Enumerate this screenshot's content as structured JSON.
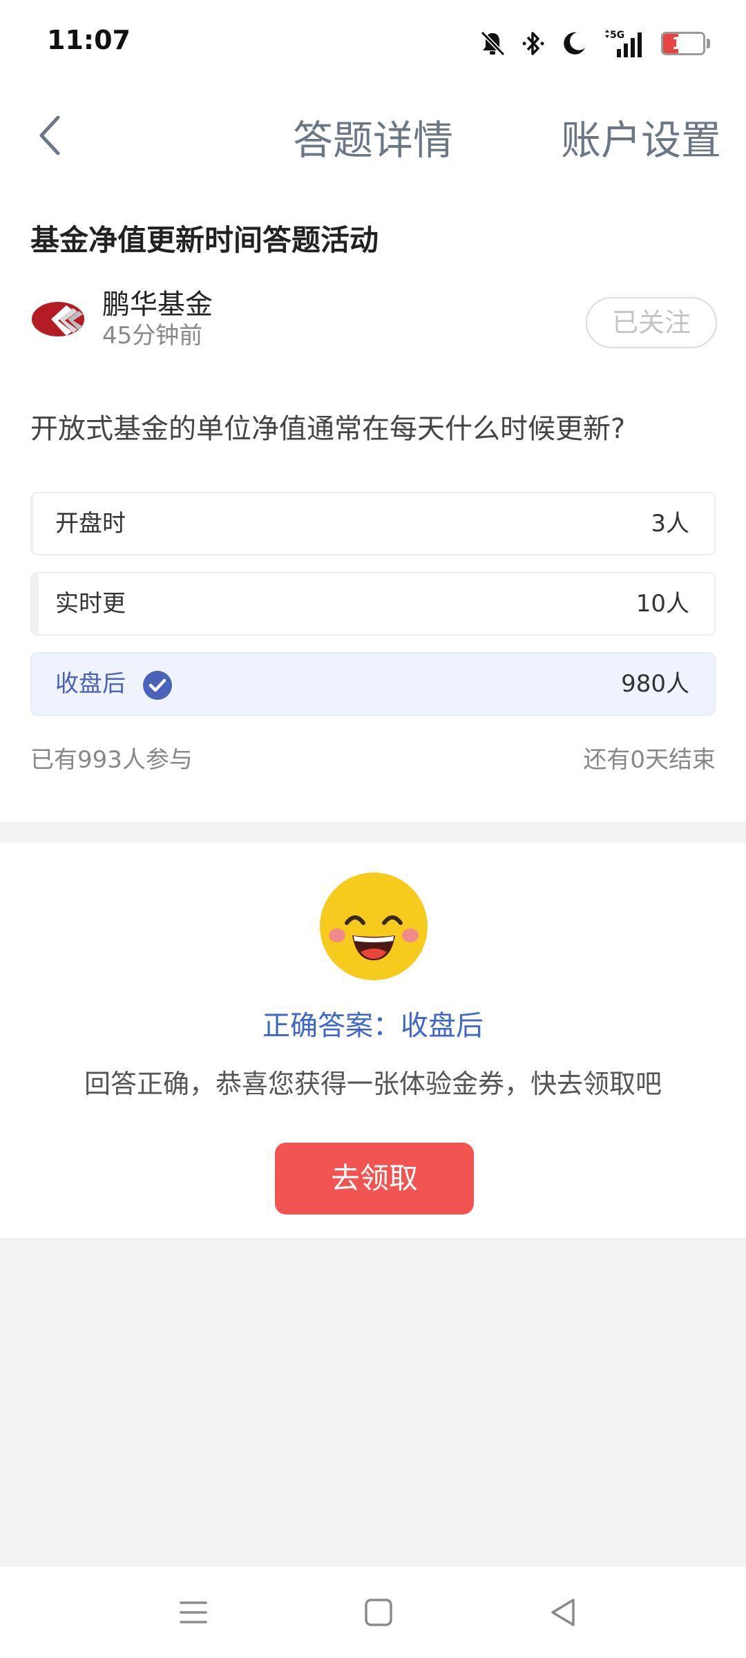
{
  "status_bar": {
    "time": "11:07",
    "battery_level": "17",
    "icons": [
      "mute-icon",
      "bluetooth-icon",
      "dnd-moon-icon",
      "5g-signal-icon",
      "battery-icon"
    ]
  },
  "header": {
    "title": "答题详情",
    "right_action": "账户设置"
  },
  "activity": {
    "title": "基金净值更新时间答题活动",
    "publisher": "鹏华基金",
    "time_ago": "45分钟前",
    "follow_label": "已关注",
    "question": "开放式基金的单位净值通常在每天什么时候更新?",
    "options": [
      {
        "label": "开盘时",
        "count": "3人",
        "share": 0.003,
        "correct": false
      },
      {
        "label": "实时更",
        "count": "10人",
        "share": 0.01,
        "correct": false
      },
      {
        "label": "收盘后",
        "count": "980人",
        "share": 0.987,
        "correct": true
      }
    ],
    "participants": "已有993人参与",
    "time_left": "还有0天结束"
  },
  "result": {
    "correct_answer": "正确答案：收盘后",
    "message": "回答正确，恭喜您获得一张体验金券，快去领取吧",
    "claim_button": "去领取"
  },
  "colors": {
    "accent_blue": "#3f66c9",
    "claim_red": "#f25452",
    "battery_red": "#e84343"
  }
}
